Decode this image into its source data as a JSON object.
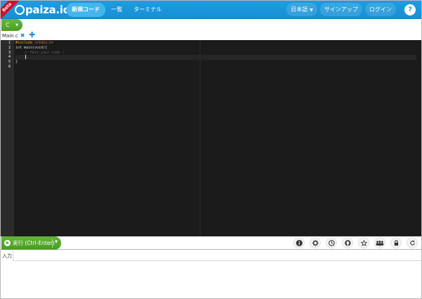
{
  "header": {
    "beta": "Beta",
    "logo_text": "paiza.io",
    "nav": [
      "新規コード",
      "一覧",
      "ターミナル"
    ],
    "language_menu": "日本語",
    "signup": "サインアップ",
    "login": "ログイン",
    "help": "?"
  },
  "lang": {
    "selected": "C"
  },
  "tabs": {
    "file": "Main.c"
  },
  "editor": {
    "lines": [
      "1",
      "2",
      "3",
      "4",
      "5",
      "6"
    ],
    "code": {
      "include_directive": "#include",
      "include_header": "<stdio.h>",
      "main_sig": "int main(void){",
      "comment": "// Here your code !",
      "close_brace": "}"
    }
  },
  "toolbar": {
    "run_label": "実行 (Ctrl-Enter)",
    "icons": [
      "info-icon",
      "gear-icon",
      "clock-icon",
      "github-icon",
      "star-icon",
      "users-icon",
      "lock-icon",
      "refresh-icon"
    ]
  },
  "input": {
    "tab_label": "入力"
  },
  "colors": {
    "navbar": "#168fd6",
    "accent_green": "#4a9b24",
    "editor_bg": "#1b1b1b",
    "beta_red": "#d0112b"
  }
}
